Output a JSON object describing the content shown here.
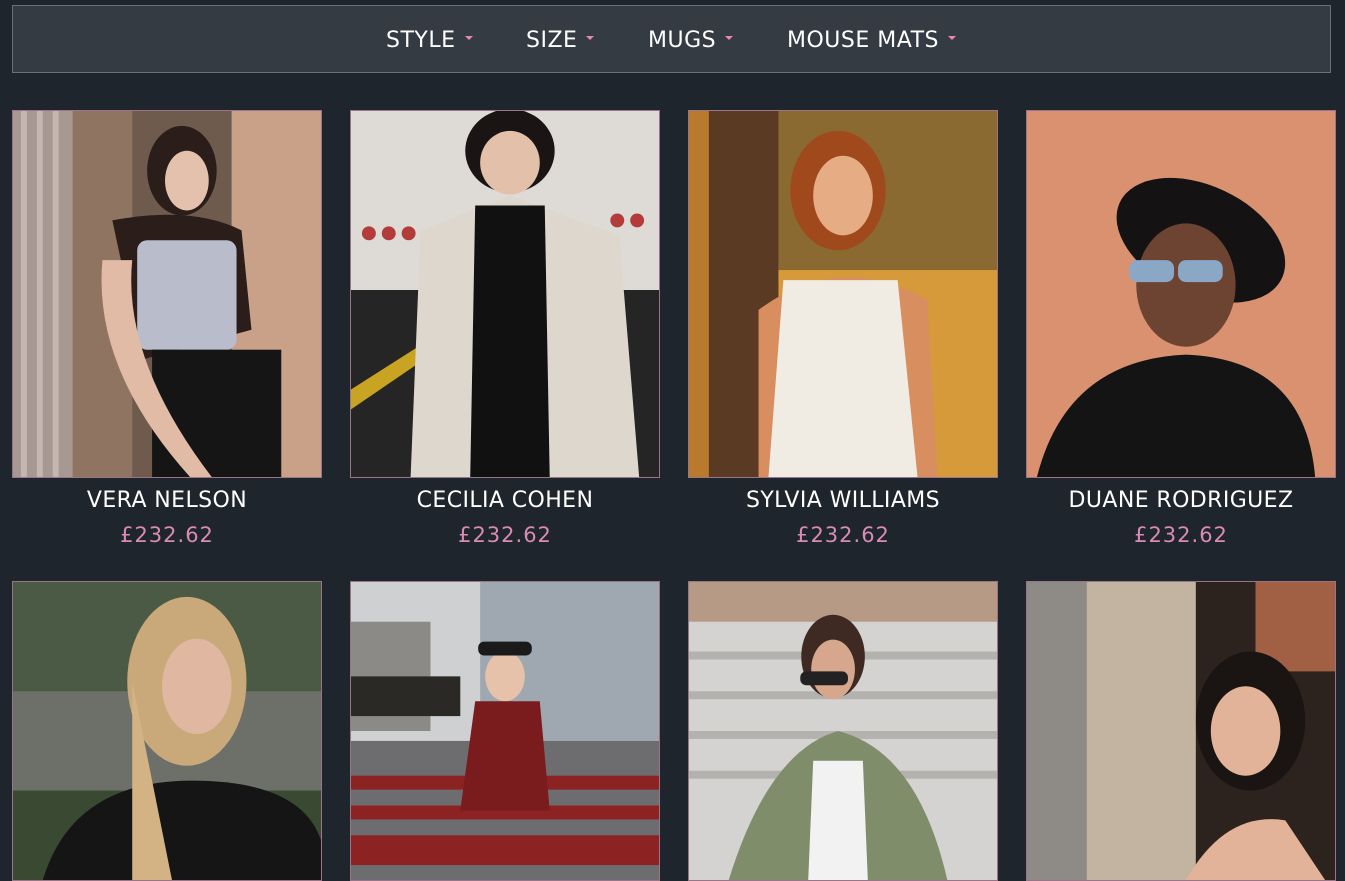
{
  "nav": {
    "items": [
      {
        "label": "STYLE"
      },
      {
        "label": "SIZE"
      },
      {
        "label": "MUGS"
      },
      {
        "label": "MOUSE MATS"
      }
    ]
  },
  "products": [
    {
      "name": "VERA NELSON",
      "price": "£232.62"
    },
    {
      "name": "CECILIA COHEN",
      "price": "£232.62"
    },
    {
      "name": "SYLVIA WILLIAMS",
      "price": "£232.62"
    },
    {
      "name": "DUANE RODRIGUEZ",
      "price": "£232.62"
    },
    {
      "name": "",
      "price": ""
    },
    {
      "name": "",
      "price": ""
    },
    {
      "name": "",
      "price": ""
    },
    {
      "name": "",
      "price": ""
    }
  ],
  "colors": {
    "background": "#1f252c",
    "nav_background": "#353b43",
    "accent": "#d98bb6"
  }
}
